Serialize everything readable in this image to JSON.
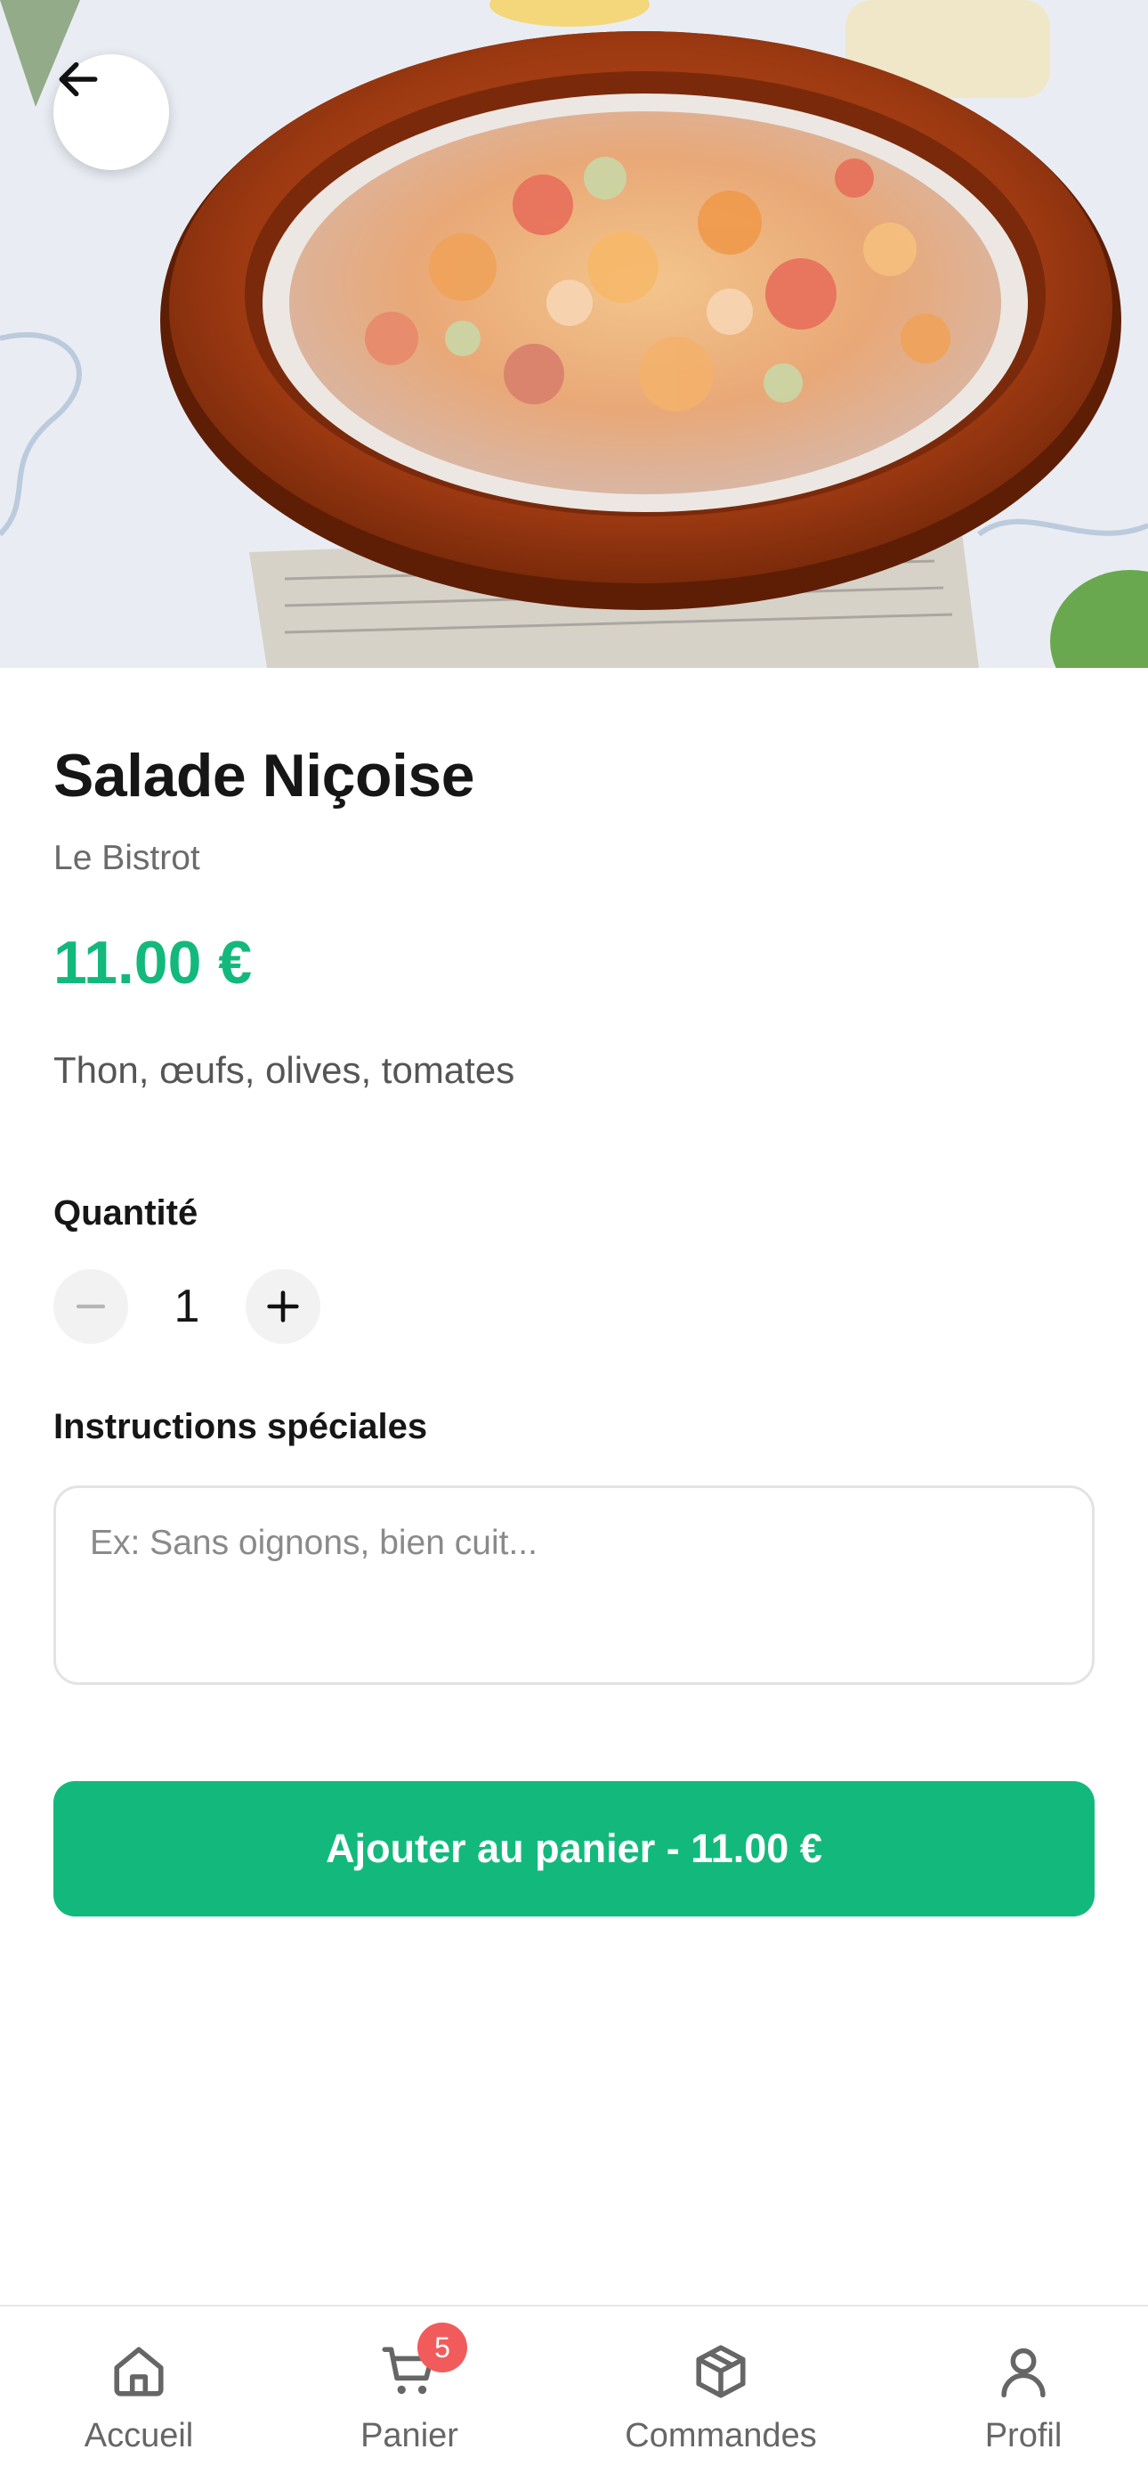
{
  "header": {
    "back_icon": "arrow-left-icon"
  },
  "product": {
    "name": "Salade Niçoise",
    "restaurant": "Le Bistrot",
    "price": "11.00 €",
    "description": "Thon, œufs, olives, tomates",
    "image_icon": "salad-bowl-photo"
  },
  "quantity": {
    "label": "Quantité",
    "value": "1",
    "minus_icon": "minus-icon",
    "plus_icon": "plus-icon"
  },
  "instructions": {
    "label": "Instructions spéciales",
    "placeholder": "Ex: Sans oignons, bien cuit...",
    "value": ""
  },
  "cta": {
    "label": "Ajouter au panier - 11.00 €"
  },
  "tabbar": {
    "items": [
      {
        "label": "Accueil",
        "icon": "home-icon"
      },
      {
        "label": "Panier",
        "icon": "cart-icon",
        "badge": "5"
      },
      {
        "label": "Commandes",
        "icon": "package-icon"
      },
      {
        "label": "Profil",
        "icon": "user-icon"
      }
    ]
  },
  "colors": {
    "accent": "#13b97c",
    "badge": "#f25b5b",
    "text": "#161616",
    "muted": "#6b6b6b"
  }
}
